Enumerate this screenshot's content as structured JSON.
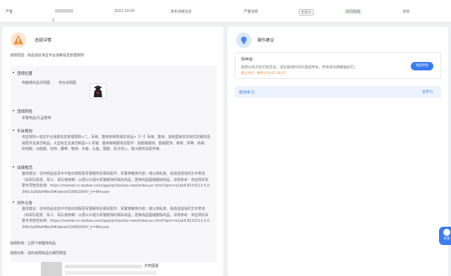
{
  "top_row": {
    "col1": "严重",
    "col2_prefix": "2",
    "date": "2022-10-05",
    "type": "发布违禁信息",
    "level": "严重违规",
    "badge": "无扣分",
    "status": "处罚完成",
    "link": "详情"
  },
  "left_panel": {
    "title": "违规详情",
    "reason_label": "违规原因：",
    "reason": "商品违反淘宝平台违禁信息管理规则",
    "location_title": "违规位置",
    "location_value": "电脑端商品详情图",
    "location_note": "存在违规图",
    "risk_title": "违规风险",
    "risk_value": "军警用品/礼品赠券",
    "rule_title": "平台规则",
    "rule_text": "淘宝规则>淘宝平台违禁信息管理规则>二、军用、警用管制类相关商品>【一】军用、警用、其他国家机关制式的服饰及其配件及其仿制品，大型标志及其仿制品>1.军警、警用特制服饰及配件：如服装服饰、服装配饰、臂章、领带、肩章、防刺服、功能服、标饰、腰带、鞋袜、手套、头盔、围脖、反光背心、警大服饰及配件等。",
    "law_title": "法律规范",
    "law_text": "整改建议：任何商品信息中不能出现假冒军警服饰及相关配件、军警穿戴类内容；或以类乱真、易造成混淆的文字表述（如军队配发、军工、军队使用等）以便公众视为军警服饰的相关商品，更换商品图或删除商品。详情参考：淘宝网非军警专项管控标准：https://market.m.taobao.com/app/qn/toutiao-new/index-pc.html?spm=a1zb9.8233112.0.0.340c3a58wHBecE#/detail/10662904?_k=64nuzw",
    "notice_title": "对外公告",
    "notice_text": "整改建议：任何商品信息中不能出现假冒军警服饰及相关配件、军警穿戴类内容；或以类乱真、易造成混淆的文字表述（如军队配发、军工、军队使用等）以便公众视为军警服饰的相关商品，更换商品图或删除商品。详情参考：淘宝网非军警专项管控标准：https://market.m.taobao.com/app/qn/toutiao-new/index-pc.html?spm=a1zb9.8233112.0.0.340c3a58wHBecE#/detail/10662904?_k=64nuzw",
    "impact_label": "违规影响：",
    "impact": "立即下架整改商品",
    "object_label": "违规对象：",
    "object": "您的违规商品已做同类型",
    "item_suffix": "打药蛋蛋"
  },
  "right_panel": {
    "title": "操作建议",
    "appeal_title": "待申诉",
    "appeal_desc": "如您对本次处罚有异议，请在有效时间内发起申诉，申诉成功将撤销处罚。",
    "deadline": "截止时间：剩余11天 05:38:07",
    "appeal_button": "发起申诉",
    "learn_label": "规则学习",
    "learn_link": "去学习"
  },
  "fab": {
    "label": "答客"
  },
  "colors": {
    "accent": "#3a7cf0",
    "warning": "#f0913b",
    "success": "#2ea650"
  }
}
